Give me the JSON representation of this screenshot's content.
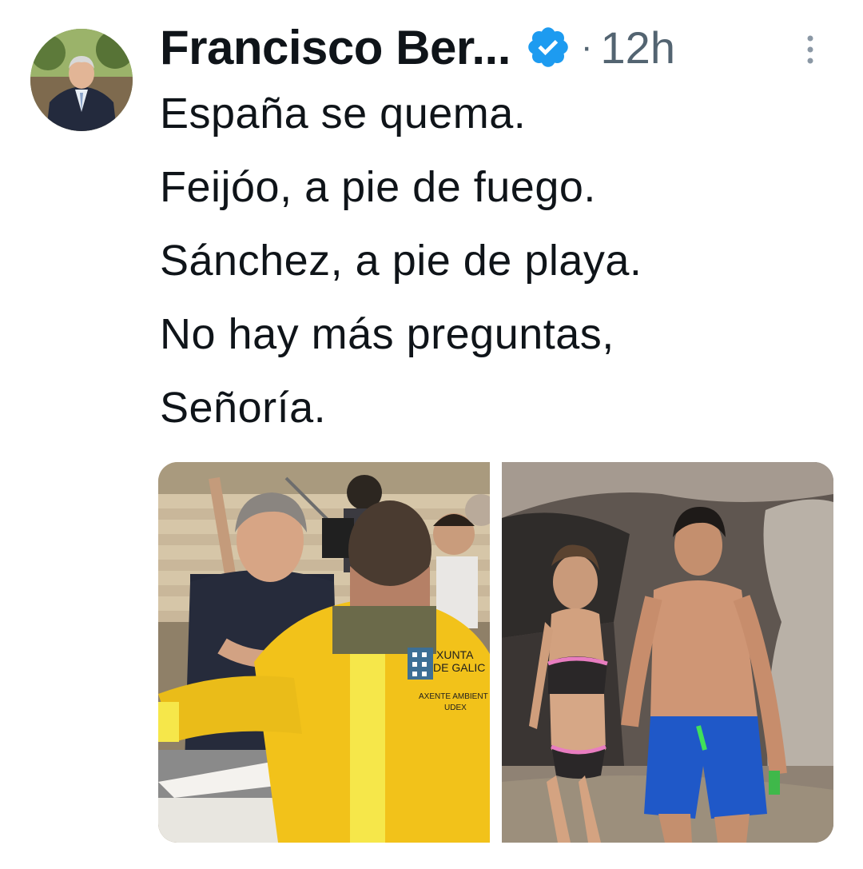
{
  "tweet": {
    "author_name": "Francisco Ber...",
    "separator": "·",
    "time": "12h",
    "lines": [
      "España se quema.",
      "Feijóo, a pie de fuego.",
      "Sánchez, a pie de playa.",
      "No hay más preguntas,",
      "Señoría."
    ]
  },
  "icons": {
    "verified": "verified-badge-icon",
    "more": "more-options-icon"
  },
  "media": {
    "left_photo_text": {
      "line1": "XUNTA",
      "line2": "DE GALIC",
      "line3": "AXENTE AMBIENT",
      "line4": "UDEX"
    }
  },
  "colors": {
    "verified_blue": "#1d9bf0",
    "secondary_text": "#536471",
    "primary_text": "#0f1419",
    "jacket_yellow": "#f2c21a"
  }
}
